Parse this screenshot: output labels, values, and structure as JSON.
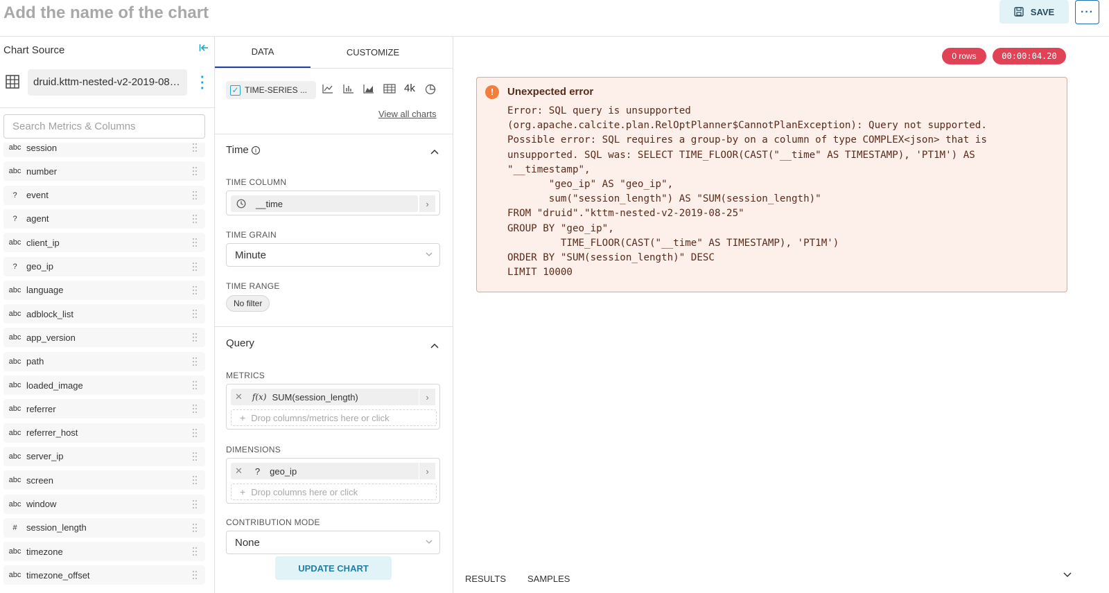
{
  "header": {
    "chart_title": "Add the name of the chart",
    "save_label": "SAVE",
    "more_label": "···"
  },
  "left_panel": {
    "heading": "Chart Source",
    "datasource": "druid.kttm-nested-v2-2019-08-25",
    "search_placeholder": "Search Metrics & Columns",
    "columns": [
      {
        "type": "abc",
        "name": "session"
      },
      {
        "type": "abc",
        "name": "number"
      },
      {
        "type": "?",
        "name": "event"
      },
      {
        "type": "?",
        "name": "agent"
      },
      {
        "type": "abc",
        "name": "client_ip"
      },
      {
        "type": "?",
        "name": "geo_ip"
      },
      {
        "type": "abc",
        "name": "language"
      },
      {
        "type": "abc",
        "name": "adblock_list"
      },
      {
        "type": "abc",
        "name": "app_version"
      },
      {
        "type": "abc",
        "name": "path"
      },
      {
        "type": "abc",
        "name": "loaded_image"
      },
      {
        "type": "abc",
        "name": "referrer"
      },
      {
        "type": "abc",
        "name": "referrer_host"
      },
      {
        "type": "abc",
        "name": "server_ip"
      },
      {
        "type": "abc",
        "name": "screen"
      },
      {
        "type": "abc",
        "name": "window"
      },
      {
        "type": "#",
        "name": "session_length"
      },
      {
        "type": "abc",
        "name": "timezone"
      },
      {
        "type": "abc",
        "name": "timezone_offset"
      }
    ]
  },
  "middle_panel": {
    "tabs": [
      {
        "label": "DATA"
      },
      {
        "label": "CUSTOMIZE"
      }
    ],
    "viz_type_label": "TIME-SERIES ...",
    "big_number_label": "4k",
    "view_all_label": "View all charts",
    "time_section": {
      "title": "Time",
      "time_column_label": "TIME COLUMN",
      "time_column_value": "__time",
      "time_grain_label": "TIME GRAIN",
      "time_grain_value": "Minute",
      "time_range_label": "TIME RANGE",
      "time_range_value": "No filter"
    },
    "query_section": {
      "title": "Query",
      "metrics_label": "METRICS",
      "metric_value": "SUM(session_length)",
      "metric_prefix": "f(x)",
      "metrics_drop": "Drop columns/metrics here or click",
      "dimensions_label": "DIMENSIONS",
      "dimension_value": "geo_ip",
      "dimensions_drop": "Drop columns here or click",
      "contribution_label": "CONTRIBUTION MODE",
      "contribution_value": "None"
    },
    "update_label": "UPDATE CHART"
  },
  "right_panel": {
    "rows_badge": "0 rows",
    "timer_badge": "00:00:04.20",
    "error_title": "Unexpected error",
    "error_message": "Error: SQL query is unsupported\n(org.apache.calcite.plan.RelOptPlanner$CannotPlanException): Query not supported.\nPossible error: SQL requires a group-by on a column of type COMPLEX<json> that is\nunsupported. SQL was: SELECT TIME_FLOOR(CAST(\"__time\" AS TIMESTAMP), 'PT1M') AS\n\"__timestamp\",\n       \"geo_ip\" AS \"geo_ip\",\n       sum(\"session_length\") AS \"SUM(session_length)\"\nFROM \"druid\".\"kttm-nested-v2-2019-08-25\"\nGROUP BY \"geo_ip\",\n         TIME_FLOOR(CAST(\"__time\" AS TIMESTAMP), 'PT1M')\nORDER BY \"SUM(session_length)\" DESC\nLIMIT 10000",
    "result_tabs": [
      {
        "label": "RESULTS"
      },
      {
        "label": "SAMPLES"
      }
    ]
  },
  "colors": {
    "accent": "#20a7c9",
    "error_bg": "#fdf0ea",
    "error_border": "#f0a486",
    "badge": "#e04355"
  }
}
